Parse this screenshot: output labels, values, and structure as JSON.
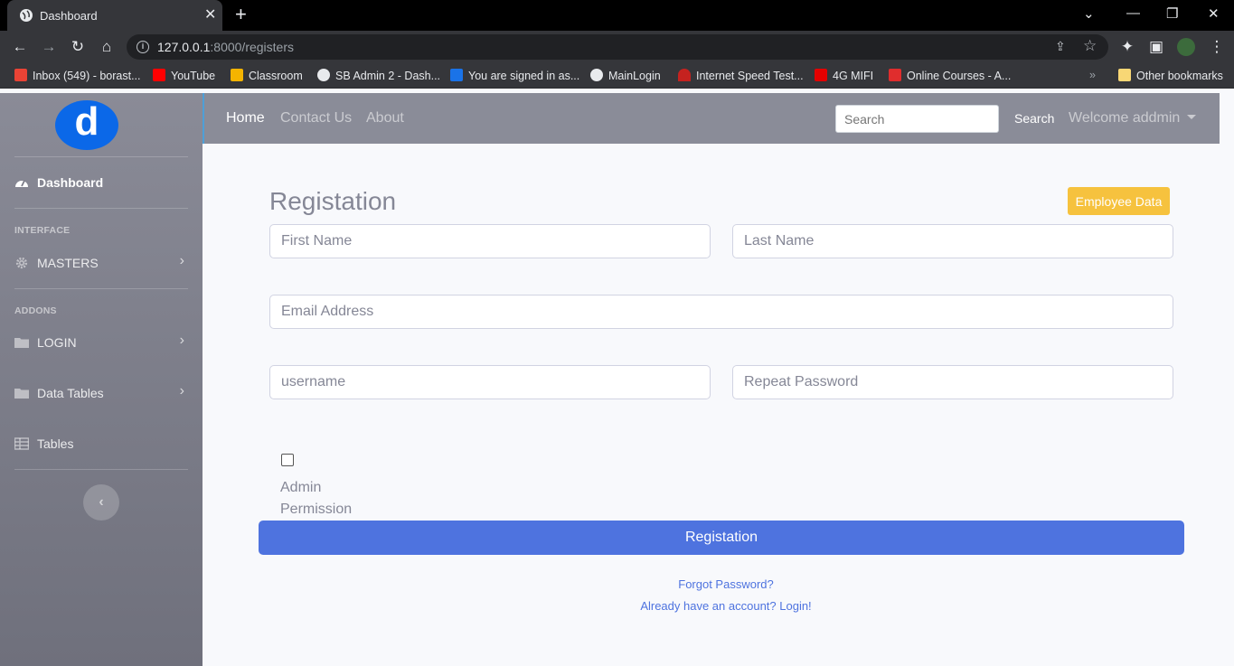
{
  "browser": {
    "tab_title": "Dashboard",
    "url_host": "127.0.0.1",
    "url_rest": ":8000/registers",
    "bookmarks": [
      {
        "label": "Inbox (549) - borast...",
        "icon": "gmail-icon",
        "color": "#ea4335"
      },
      {
        "label": "YouTube",
        "icon": "youtube-icon",
        "color": "#ff0000"
      },
      {
        "label": "Classroom",
        "icon": "classroom-icon",
        "color": "#f4b400"
      },
      {
        "label": "SB Admin 2 - Dash...",
        "icon": "globe-icon",
        "color": "#e8eaed"
      },
      {
        "label": "You are signed in as...",
        "icon": "s-icon",
        "color": "#1a73e8"
      },
      {
        "label": "MainLogin",
        "icon": "globe-icon",
        "color": "#e8eaed"
      },
      {
        "label": "Internet Speed Test...",
        "icon": "speed-icon",
        "color": "#c5221f"
      },
      {
        "label": "4G MIFI",
        "icon": "airtel-icon",
        "color": "#e40000"
      },
      {
        "label": "Online Courses - A...",
        "icon": "udemy-icon",
        "color": "#e02d2d"
      }
    ],
    "other_bookmarks": "Other bookmarks"
  },
  "sidebar": {
    "brand": "d",
    "dashboard": "Dashboard",
    "heading_interface": "INTERFACE",
    "masters": "MASTERS",
    "heading_addons": "ADDONS",
    "login": "LOGIN",
    "data_tables": "Data Tables",
    "tables": "Tables"
  },
  "topnav": {
    "home": "Home",
    "contact": "Contact Us",
    "about": "About",
    "search_placeholder": "Search",
    "search_button": "Search",
    "user": "Welcome addmin"
  },
  "form": {
    "title": "Registation",
    "employee_button": "Employee Data",
    "first_name_placeholder": "First Name",
    "last_name_placeholder": "Last Name",
    "email_placeholder": "Email Address",
    "username_placeholder": "username",
    "repeat_password_placeholder": "Repeat Password",
    "admin_permission_label": "Admin Permission",
    "submit_label": "Registation",
    "forgot_password": "Forgot Password?",
    "login_link": "Already have an account? Login!"
  },
  "colors": {
    "primary": "#4e73df",
    "warning": "#f6c23e",
    "brand_blue": "#0b68e8"
  }
}
